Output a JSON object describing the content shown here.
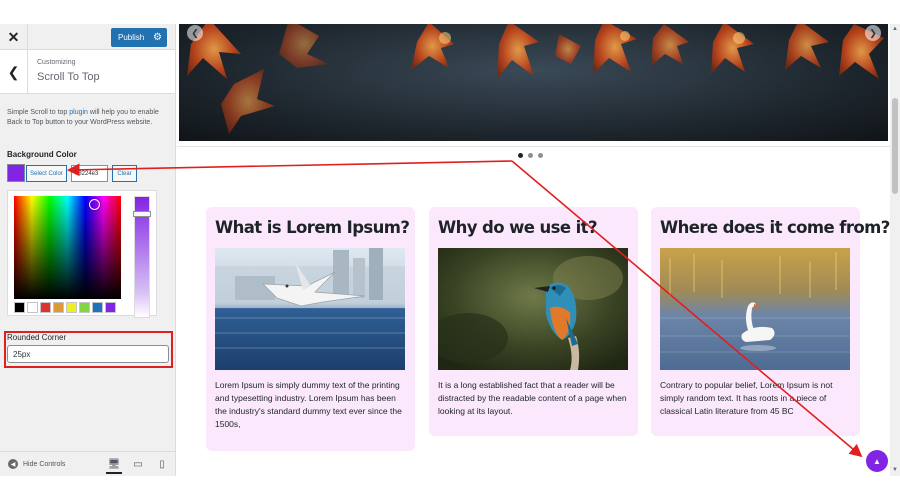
{
  "sidebar": {
    "close_label": "✕",
    "publish_label": "Publish",
    "section_small": "Customizing",
    "section_title": "Scroll To Top",
    "description_prefix": "Simple Scroll to top ",
    "description_link": "plugin",
    "description_suffix": " will help you to enable Back to Top button to your WordPress website.",
    "background_color": {
      "label": "Background Color",
      "select_label": "Select Color",
      "hex_value": "#8224e3",
      "clear_label": "Clear",
      "value_color": "#8224e3",
      "palette": [
        "#000000",
        "#ffffff",
        "#dd3333",
        "#dd9933",
        "#eeee22",
        "#81d742",
        "#1e73be",
        "#8224e3"
      ]
    },
    "rounded_corner": {
      "label": "Rounded Corner",
      "value": "25px"
    },
    "footer": {
      "hide_label": "Hide Controls"
    }
  },
  "preview": {
    "cards": [
      {
        "title": "What is Lorem Ipsum?",
        "text": "Lorem Ipsum is simply dummy text of the printing and typesetting industry. Lorem Ipsum has been the industry's standard dummy text ever since the 1500s,"
      },
      {
        "title": "Why do we use it?",
        "text": "It is a long established fact that a reader will be distracted by the readable content of a page when looking at its layout."
      },
      {
        "title": "Where does it come from?",
        "text": "Contrary to popular belief, Lorem Ipsum is not simply random text. It has roots in a piece of classical Latin literature from 45 BC"
      }
    ],
    "slider_dots": 3,
    "card_background": "#fbe8fd"
  },
  "colors": {
    "accent": "#8224e3",
    "publish": "#2271b1",
    "annotation": "#e02020"
  }
}
